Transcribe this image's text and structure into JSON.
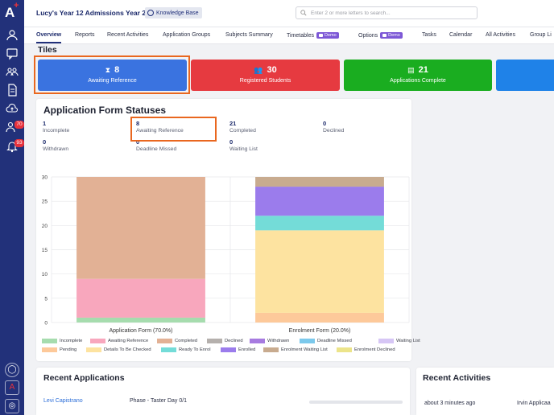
{
  "header": {
    "app_title": "Lucy's Year 12 Admissions Year 2...",
    "knowledge_base_label": "Knowledge Base",
    "search_placeholder": "Enter 2 or more letters to search..."
  },
  "sidebar": {
    "logo_text": "A",
    "badges": {
      "applicants": "70",
      "notifications": "93"
    },
    "bottom_icons": [
      "circle-logo-icon",
      "a-logo-icon",
      "instagram-icon"
    ]
  },
  "tabs": [
    {
      "label": "Overview",
      "active": true
    },
    {
      "label": "Reports"
    },
    {
      "label": "Recent Activities"
    },
    {
      "label": "Application Groups"
    },
    {
      "label": "Subjects Summary"
    },
    {
      "label": "Timetables",
      "badge": "Demo"
    },
    {
      "label": "Options",
      "badge": "Demo"
    },
    {
      "label": "Tasks"
    },
    {
      "label": "Calendar"
    },
    {
      "label": "All Activities"
    },
    {
      "label": "Group Li"
    }
  ],
  "tiles": {
    "section_title": "Tiles",
    "items": [
      {
        "value": "8",
        "label": "Awaiting Reference",
        "icon": "hourglass-icon",
        "color": "#3a73e0"
      },
      {
        "value": "30",
        "label": "Registered Students",
        "icon": "users-icon",
        "color": "#e63a40"
      },
      {
        "value": "21",
        "label": "Applications Complete",
        "icon": "checklist-icon",
        "color": "#1aad20"
      },
      {
        "value": "",
        "label": "",
        "color": "#1f82e8"
      }
    ]
  },
  "statuses": {
    "title": "Application Form Statuses",
    "items": [
      {
        "value": "1",
        "label": "Incomplete"
      },
      {
        "value": "8",
        "label": "Awaiting Reference"
      },
      {
        "value": "21",
        "label": "Completed"
      },
      {
        "value": "0",
        "label": "Declined"
      },
      {
        "value": "0",
        "label": "Withdrawn"
      },
      {
        "value": "0",
        "label": "Deadline Missed"
      },
      {
        "value": "0",
        "label": "Waiting List"
      }
    ]
  },
  "chart_data": {
    "type": "bar",
    "stacked": true,
    "categories": [
      "Application Form (70.0%)",
      "Enrolment Form (20.0%)"
    ],
    "ylim": [
      0,
      30
    ],
    "yticks": [
      0,
      5,
      10,
      15,
      20,
      25,
      30
    ],
    "grid": true,
    "legend_position": "bottom",
    "series": [
      {
        "name": "Incomplete",
        "color": "#a6dcae",
        "values": [
          1,
          0
        ]
      },
      {
        "name": "Awaiting Reference",
        "color": "#f8a7bd",
        "values": [
          8,
          0
        ]
      },
      {
        "name": "Completed",
        "color": "#e2b195",
        "values": [
          21,
          0
        ]
      },
      {
        "name": "Declined",
        "color": "#b5b0ad",
        "values": [
          0,
          0
        ]
      },
      {
        "name": "Withdrawn",
        "color": "#a77be0",
        "values": [
          0,
          0
        ]
      },
      {
        "name": "Deadline Missed",
        "color": "#7cc9ec",
        "values": [
          0,
          0
        ]
      },
      {
        "name": "Waiting List",
        "color": "#d6c6f5",
        "values": [
          0,
          0
        ]
      },
      {
        "name": "Pending",
        "color": "#fdc99a",
        "values": [
          0,
          2
        ]
      },
      {
        "name": "Details To Be Checked",
        "color": "#fde3a0",
        "values": [
          0,
          17
        ]
      },
      {
        "name": "Ready To Enrol",
        "color": "#74dcd8",
        "values": [
          0,
          3
        ]
      },
      {
        "name": "Enrolled",
        "color": "#9b7cec",
        "values": [
          0,
          6
        ]
      },
      {
        "name": "Enrolment Waiting List",
        "color": "#c8ab8f",
        "values": [
          0,
          2
        ]
      },
      {
        "name": "Enrolment Declined",
        "color": "#ece48a",
        "values": [
          0,
          0
        ]
      }
    ]
  },
  "recent_applications": {
    "title": "Recent Applications",
    "rows": [
      {
        "name": "Levi Capistrano",
        "phase": "Phase - Taster Day 0/1"
      }
    ]
  },
  "recent_activities": {
    "title": "Recent Activities",
    "rows": [
      {
        "time": "about 3 minutes ago",
        "name": "Irvin Applicaa"
      }
    ]
  }
}
